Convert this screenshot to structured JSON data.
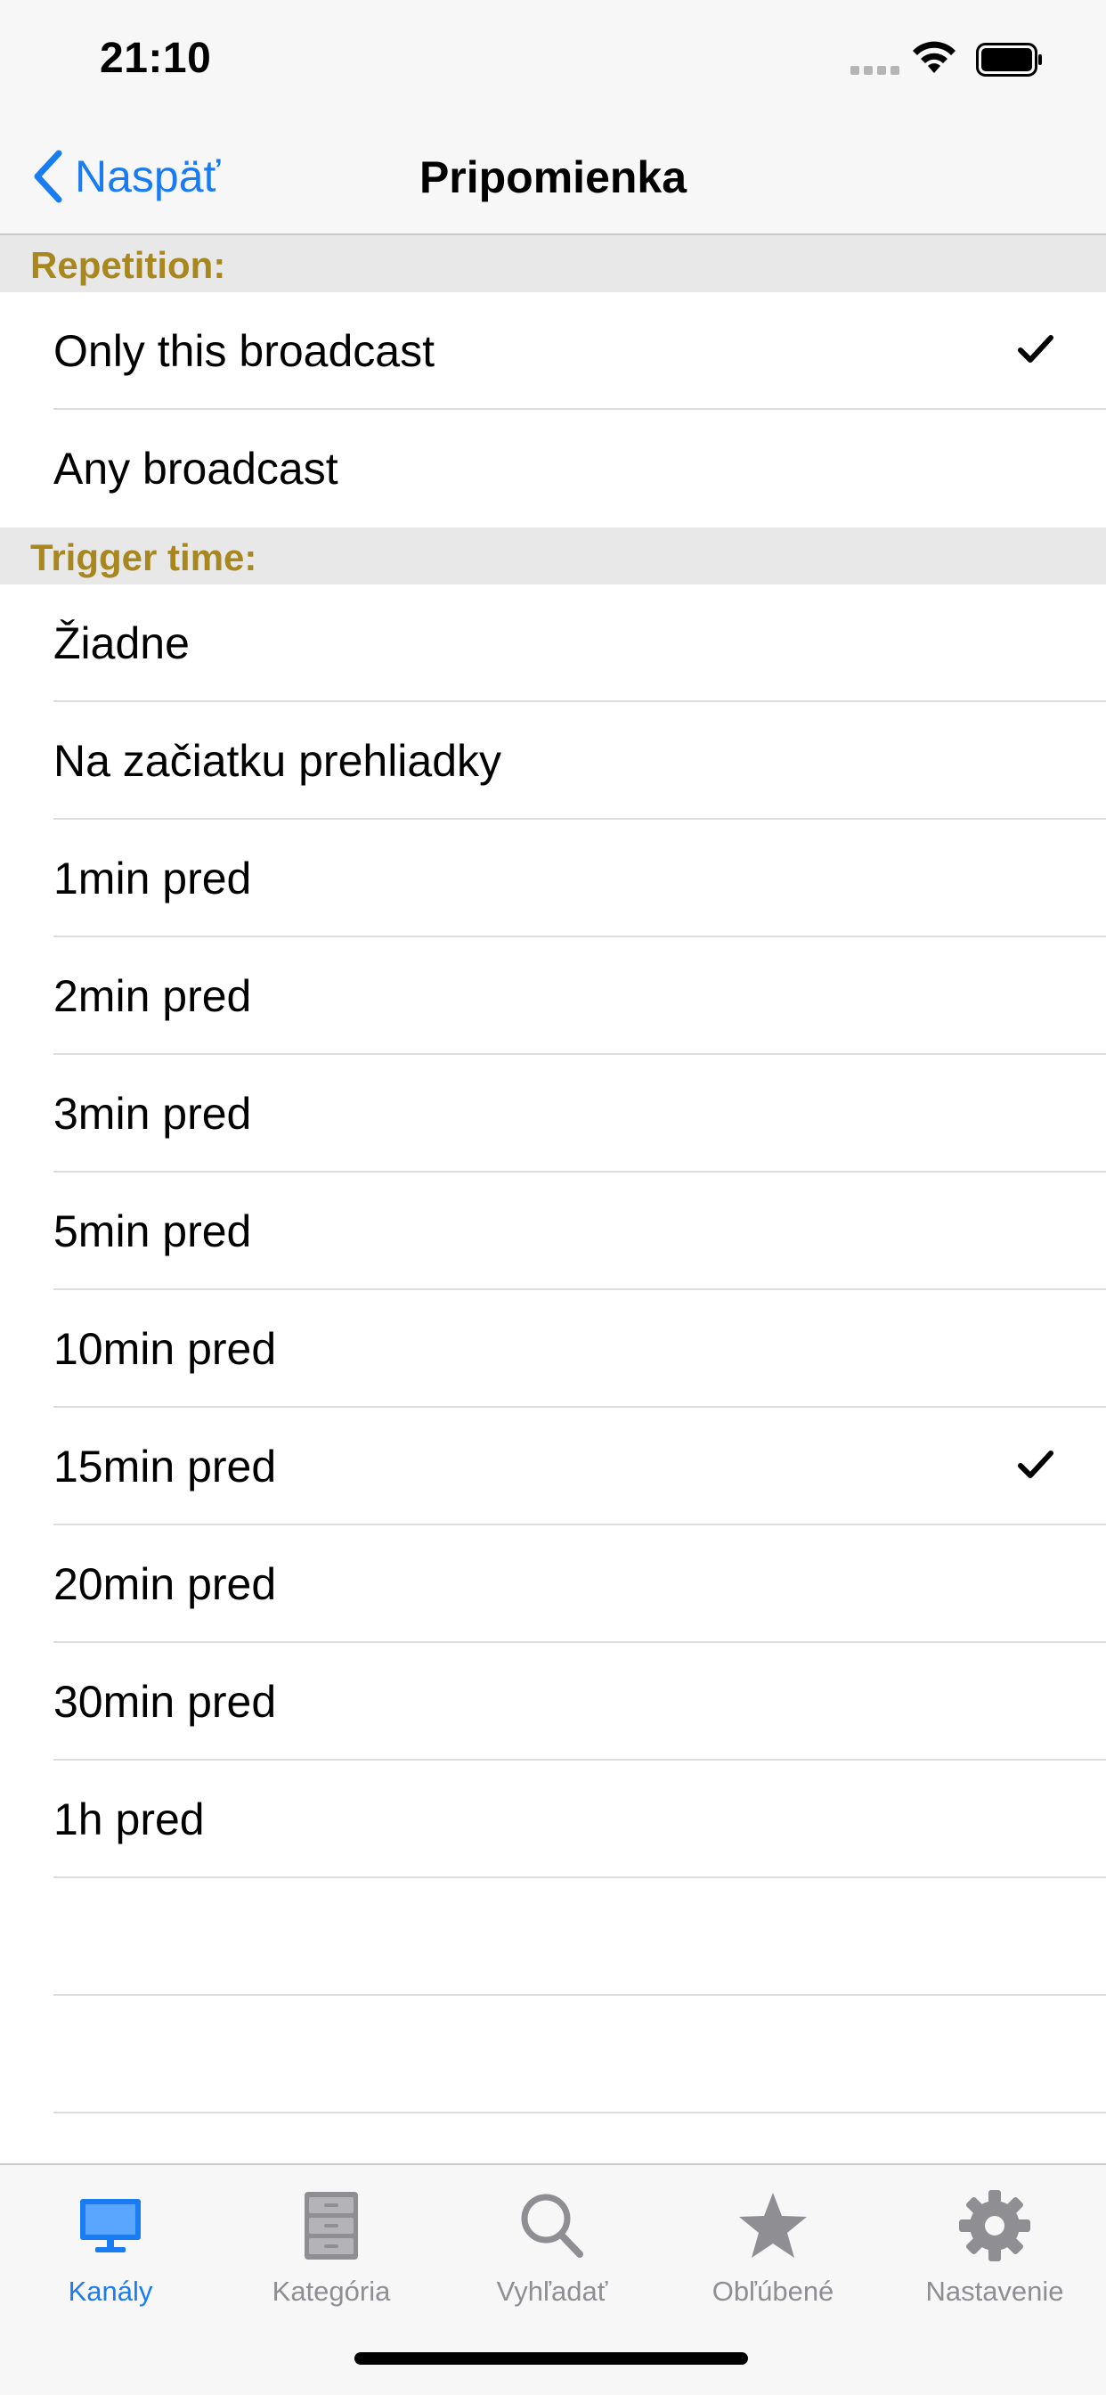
{
  "status_bar": {
    "time": "21:10"
  },
  "nav": {
    "back_label": "Naspäť",
    "title": "Pripomienka"
  },
  "sections": [
    {
      "header": "Repetition:",
      "rows": [
        {
          "label": "Only this broadcast",
          "checked": true
        },
        {
          "label": "Any broadcast",
          "checked": false
        }
      ]
    },
    {
      "header": "Trigger time:",
      "rows": [
        {
          "label": "Žiadne",
          "checked": false
        },
        {
          "label": "Na začiatku prehliadky",
          "checked": false
        },
        {
          "label": "1min pred",
          "checked": false
        },
        {
          "label": "2min pred",
          "checked": false
        },
        {
          "label": "3min pred",
          "checked": false
        },
        {
          "label": "5min pred",
          "checked": false
        },
        {
          "label": "10min pred",
          "checked": false
        },
        {
          "label": "15min pred",
          "checked": true
        },
        {
          "label": "20min pred",
          "checked": false
        },
        {
          "label": "30min pred",
          "checked": false
        },
        {
          "label": "1h pred",
          "checked": false
        }
      ]
    }
  ],
  "tabs": [
    {
      "label": "Kanály",
      "icon": "tv-monitor-icon",
      "active": true
    },
    {
      "label": "Kategória",
      "icon": "file-cabinet-icon",
      "active": false
    },
    {
      "label": "Vyhľadať",
      "icon": "search-icon",
      "active": false
    },
    {
      "label": "Obľúbené",
      "icon": "star-icon",
      "active": false
    },
    {
      "label": "Nastavenie",
      "icon": "gear-icon",
      "active": false
    }
  ],
  "colors": {
    "accent": "#1a7cf2",
    "section_header_text": "#a8871e",
    "section_header_bg": "#e8e8e8",
    "inactive_tab": "#8e8e93"
  }
}
